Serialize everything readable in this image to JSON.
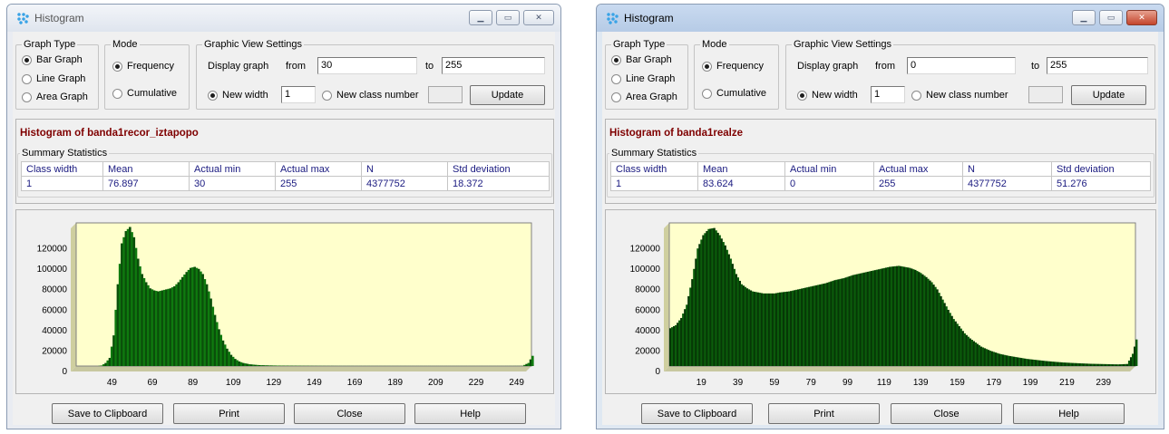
{
  "windows": [
    {
      "title": "Histogram",
      "graph_type": {
        "legend": "Graph Type",
        "options": [
          "Bar Graph",
          "Line Graph",
          "Area Graph"
        ]
      },
      "mode": {
        "legend": "Mode",
        "options": [
          "Frequency",
          "Cumulative"
        ]
      },
      "view": {
        "legend": "Graphic View Settings",
        "display_label": "Display graph",
        "from_label": "from",
        "from_value": "30",
        "to_label": "to",
        "to_value": "255",
        "new_width_label": "New width",
        "new_width_value": "1",
        "new_class_label": "New class number",
        "update_label": "Update"
      },
      "hist_title": "Histogram of banda1recor_iztapopo",
      "summary_legend": "Summary Statistics",
      "stats_headers": [
        "Class width",
        "Mean",
        "Actual min",
        "Actual max",
        "N",
        "Std deviation"
      ],
      "stats_values": [
        "1",
        "76.897",
        "30",
        "255",
        "4377752",
        "18.372"
      ],
      "buttons": [
        "Save to Clipboard",
        "Print",
        "Close",
        "Help"
      ],
      "colors": {
        "bar": "#0f7a0f",
        "bar_dark": "#0a4f0a",
        "plot_bg": "#ffffcc"
      },
      "chart_data": {
        "type": "bar",
        "x_tick_labels": [
          "49",
          "69",
          "89",
          "109",
          "129",
          "149",
          "169",
          "189",
          "209",
          "229",
          "249"
        ],
        "y_tick_labels": [
          "0",
          "20000",
          "40000",
          "60000",
          "80000",
          "100000",
          "120000"
        ],
        "xlim": [
          30,
          255
        ],
        "ylim": [
          0,
          140000
        ],
        "x": [
          30,
          40,
          42,
          44,
          46,
          48,
          50,
          52,
          54,
          56,
          58,
          60,
          62,
          64,
          66,
          68,
          70,
          72,
          74,
          76,
          78,
          80,
          82,
          84,
          86,
          88,
          90,
          92,
          94,
          96,
          98,
          100,
          102,
          104,
          106,
          108,
          110,
          112,
          115,
          118,
          120,
          125,
          130,
          140,
          150,
          160,
          180,
          200,
          220,
          240,
          250,
          253,
          255
        ],
        "values": [
          0,
          0,
          500,
          3000,
          8000,
          30000,
          80000,
          120000,
          132000,
          136000,
          126000,
          105000,
          90000,
          82000,
          76000,
          74000,
          73000,
          74000,
          75000,
          76000,
          78000,
          82000,
          87000,
          92000,
          96000,
          97000,
          95000,
          90000,
          80000,
          66000,
          50000,
          36000,
          25000,
          17000,
          11000,
          7000,
          4500,
          3000,
          1800,
          1200,
          900,
          600,
          400,
          250,
          150,
          100,
          80,
          60,
          50,
          50,
          100,
          3000,
          10000
        ]
      }
    },
    {
      "title": "Histogram",
      "graph_type": {
        "legend": "Graph Type",
        "options": [
          "Bar Graph",
          "Line Graph",
          "Area Graph"
        ]
      },
      "mode": {
        "legend": "Mode",
        "options": [
          "Frequency",
          "Cumulative"
        ]
      },
      "view": {
        "legend": "Graphic View Settings",
        "display_label": "Display graph",
        "from_label": "from",
        "from_value": "0",
        "to_label": "to",
        "to_value": "255",
        "new_width_label": "New width",
        "new_width_value": "1",
        "new_class_label": "New class number",
        "update_label": "Update"
      },
      "hist_title": "Histogram of banda1realze",
      "summary_legend": "Summary Statistics",
      "stats_headers": [
        "Class width",
        "Mean",
        "Actual min",
        "Actual max",
        "N",
        "Std deviation"
      ],
      "stats_values": [
        "1",
        "83.624",
        "0",
        "255",
        "4377752",
        "51.276"
      ],
      "buttons": [
        "Save to Clipboard",
        "Print",
        "Close",
        "Help"
      ],
      "colors": {
        "bar": "#0b5c0b",
        "bar_dark": "#063806",
        "plot_bg": "#ffffcc"
      },
      "chart_data": {
        "type": "bar",
        "x_tick_labels": [
          "19",
          "39",
          "59",
          "79",
          "99",
          "119",
          "139",
          "159",
          "179",
          "199",
          "219",
          "239"
        ],
        "y_tick_labels": [
          "0",
          "20000",
          "40000",
          "60000",
          "80000",
          "100000",
          "120000"
        ],
        "xlim": [
          0,
          255
        ],
        "ylim": [
          0,
          140000
        ],
        "x": [
          0,
          3,
          6,
          9,
          12,
          15,
          18,
          21,
          24,
          27,
          30,
          33,
          36,
          39,
          42,
          45,
          48,
          51,
          54,
          57,
          60,
          65,
          70,
          75,
          80,
          85,
          90,
          95,
          100,
          105,
          110,
          115,
          120,
          125,
          128,
          131,
          134,
          137,
          140,
          143,
          146,
          149,
          152,
          155,
          158,
          161,
          164,
          167,
          170,
          175,
          180,
          185,
          190,
          195,
          200,
          205,
          210,
          215,
          220,
          225,
          230,
          235,
          240,
          245,
          250,
          253,
          255
        ],
        "values": [
          37000,
          40000,
          47000,
          60000,
          85000,
          115000,
          128000,
          134000,
          135000,
          128000,
          118000,
          105000,
          90000,
          80000,
          76000,
          73000,
          72000,
          71000,
          71000,
          71000,
          72000,
          73000,
          75000,
          77000,
          79000,
          81000,
          84000,
          86000,
          89000,
          91000,
          93000,
          95000,
          97000,
          98000,
          97000,
          96000,
          94000,
          91000,
          87000,
          82000,
          75000,
          65000,
          55000,
          46000,
          39000,
          32000,
          27000,
          23000,
          19000,
          15000,
          12000,
          10000,
          8500,
          7000,
          6000,
          5000,
          4200,
          3500,
          3000,
          2600,
          2200,
          2000,
          1800,
          1600,
          2000,
          12000,
          26000
        ]
      }
    }
  ]
}
